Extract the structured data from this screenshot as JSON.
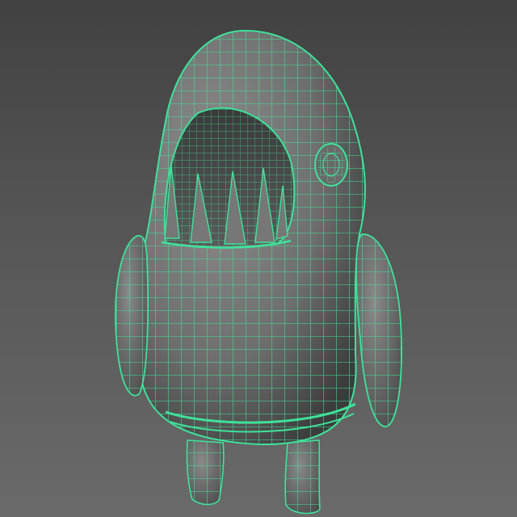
{
  "viewport": {
    "background_top": "#414141",
    "background_bottom": "#6a6a6a",
    "wire_color": "#3ee29a",
    "shade_color": "#7a7a7a",
    "selection": "mesh-wireframe-selected"
  },
  "model": {
    "parts": [
      "body",
      "head",
      "mouth",
      "teeth",
      "eye",
      "left-arm",
      "right-arm",
      "left-leg",
      "right-leg",
      "belt-ring"
    ]
  }
}
